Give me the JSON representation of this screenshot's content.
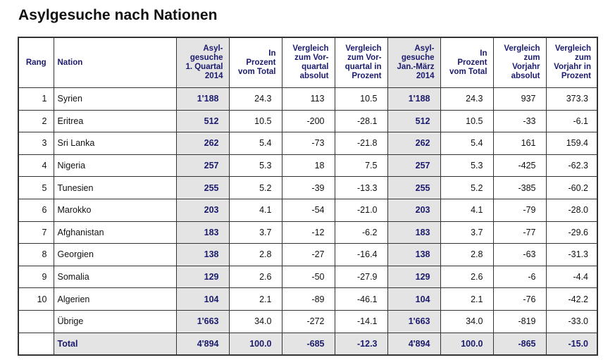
{
  "title": "Asylgesuche nach Nationen",
  "colors": {
    "header_text": "#1a1a6e",
    "shade": "#e4e4e4",
    "border": "#333333"
  },
  "headers": [
    "Rang",
    "Nation",
    "Asyl- gesuche 1. Quartal 2014",
    "In Prozent vom Total",
    "Vergleich zum Vor- quartal absolut",
    "Vergleich zum Vor- quartal in Prozent",
    "Asyl- gesuche Jan.-März 2014",
    "In Prozent vom Total",
    "Vergleich zum Vorjahr absolut",
    "Vergleich zum Vorjahr in Prozent"
  ],
  "header_lines": [
    [
      "Rang"
    ],
    [
      "Nation"
    ],
    [
      "Asyl-",
      "gesuche",
      "1. Quartal",
      "2014"
    ],
    [
      "In",
      "Prozent",
      "vom Total"
    ],
    [
      "Vergleich",
      "zum Vor-",
      "quartal",
      "absolut"
    ],
    [
      "Vergleich",
      "zum Vor-",
      "quartal in",
      "Prozent"
    ],
    [
      "Asyl-",
      "gesuche",
      "Jan.-März",
      "2014"
    ],
    [
      "In",
      "Prozent",
      "vom Total"
    ],
    [
      "Vergleich",
      "zum",
      "Vorjahr",
      "absolut"
    ],
    [
      "Vergleich",
      "zum",
      "Vorjahr in",
      "Prozent"
    ]
  ],
  "rows": [
    [
      "1",
      "Syrien",
      "1'188",
      "24.3",
      "113",
      "10.5",
      "1'188",
      "24.3",
      "937",
      "373.3"
    ],
    [
      "2",
      "Eritrea",
      "512",
      "10.5",
      "-200",
      "-28.1",
      "512",
      "10.5",
      "-33",
      "-6.1"
    ],
    [
      "3",
      "Sri Lanka",
      "262",
      "5.4",
      "-73",
      "-21.8",
      "262",
      "5.4",
      "161",
      "159.4"
    ],
    [
      "4",
      "Nigeria",
      "257",
      "5.3",
      "18",
      "7.5",
      "257",
      "5.3",
      "-425",
      "-62.3"
    ],
    [
      "5",
      "Tunesien",
      "255",
      "5.2",
      "-39",
      "-13.3",
      "255",
      "5.2",
      "-385",
      "-60.2"
    ],
    [
      "6",
      "Marokko",
      "203",
      "4.1",
      "-54",
      "-21.0",
      "203",
      "4.1",
      "-79",
      "-28.0"
    ],
    [
      "7",
      "Afghanistan",
      "183",
      "3.7",
      "-12",
      "-6.2",
      "183",
      "3.7",
      "-77",
      "-29.6"
    ],
    [
      "8",
      "Georgien",
      "138",
      "2.8",
      "-27",
      "-16.4",
      "138",
      "2.8",
      "-63",
      "-31.3"
    ],
    [
      "9",
      "Somalia",
      "129",
      "2.6",
      "-50",
      "-27.9",
      "129",
      "2.6",
      "-6",
      "-4.4"
    ],
    [
      "10",
      "Algerien",
      "104",
      "2.1",
      "-89",
      "-46.1",
      "104",
      "2.1",
      "-76",
      "-42.2"
    ],
    [
      "",
      "Übrige",
      "1'663",
      "34.0",
      "-272",
      "-14.1",
      "1'663",
      "34.0",
      "-819",
      "-33.0"
    ]
  ],
  "total": [
    "",
    "Total",
    "4'894",
    "100.0",
    "-685",
    "-12.3",
    "4'894",
    "100.0",
    "-865",
    "-15.0"
  ]
}
